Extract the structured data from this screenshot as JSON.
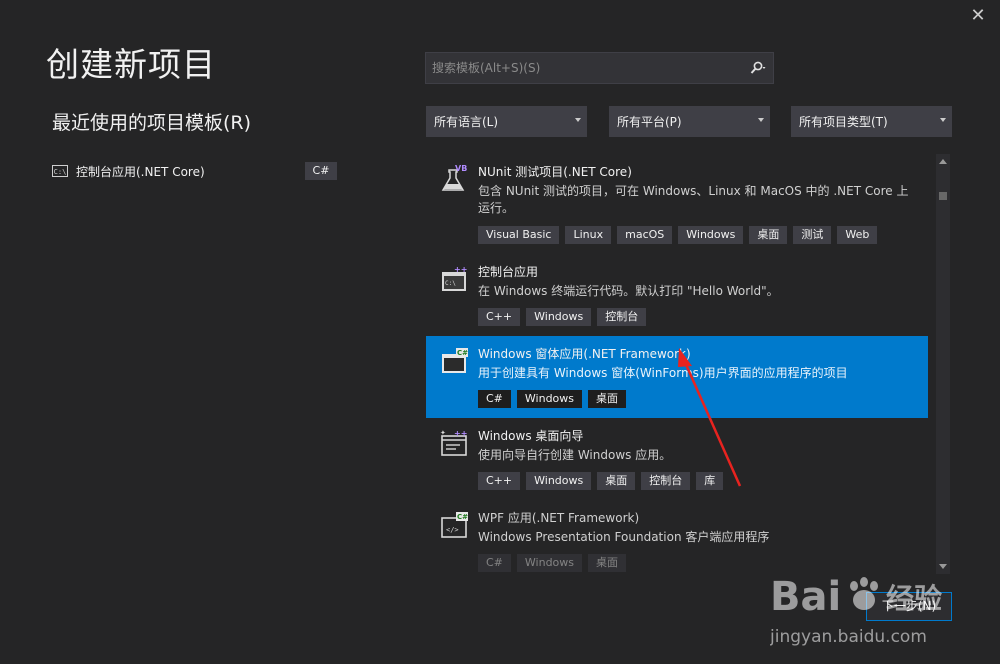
{
  "window": {
    "close_glyph": "✕"
  },
  "header": {
    "title": "创建新项目"
  },
  "recent": {
    "title": "最近使用的项目模板(R)",
    "items": [
      {
        "icon": "console-icon",
        "icon_text": "C:\\",
        "label": "控制台应用(.NET Core)",
        "language": "C#"
      }
    ]
  },
  "search": {
    "placeholder": "搜索模板(Alt+S)(S)"
  },
  "filters": {
    "language": "所有语言(L)",
    "platform": "所有平台(P)",
    "project_type": "所有项目类型(T)"
  },
  "templates": [
    {
      "name": "NUnit 测试项目(.NET Core)",
      "description": "包含 NUnit 测试的项目，可在 Windows、Linux 和 MacOS 中的 .NET Core 上运行。",
      "tags": [
        "Visual Basic",
        "Linux",
        "macOS",
        "Windows",
        "桌面",
        "测试",
        "Web"
      ],
      "icon": "flask-vb-icon",
      "badge": "VB"
    },
    {
      "name": "控制台应用",
      "description": "在 Windows 终端运行代码。默认打印 \"Hello World\"。",
      "tags": [
        "C++",
        "Windows",
        "控制台"
      ],
      "icon": "console-cpp-icon",
      "badge": "C:\\"
    },
    {
      "name": "Windows 窗体应用(.NET Framework)",
      "description": "用于创建具有 Windows 窗体(WinForms)用户界面的应用程序的项目",
      "tags": [
        "C#",
        "Windows",
        "桌面"
      ],
      "icon": "winforms-cs-icon",
      "badge": "C#",
      "selected": true
    },
    {
      "name": "Windows 桌面向导",
      "description": "使用向导自行创建 Windows 应用。",
      "tags": [
        "C++",
        "Windows",
        "桌面",
        "控制台",
        "库"
      ],
      "icon": "desktop-wizard-cpp-icon"
    },
    {
      "name": "WPF 应用(.NET Framework)",
      "description": "Windows Presentation Foundation 客户端应用程序",
      "tags": [
        "C#",
        "Windows",
        "桌面"
      ],
      "icon": "wpf-cs-icon",
      "badge": "C#"
    }
  ],
  "footer": {
    "next_label": "下一步(N)"
  },
  "watermark": {
    "brand": "Bai",
    "brand2": "经验",
    "url": "jingyan.baidu.com"
  },
  "colors": {
    "accent": "#007acc",
    "background": "#252526",
    "tag_bg": "#3f3f46",
    "arrow": "#e8231f"
  }
}
